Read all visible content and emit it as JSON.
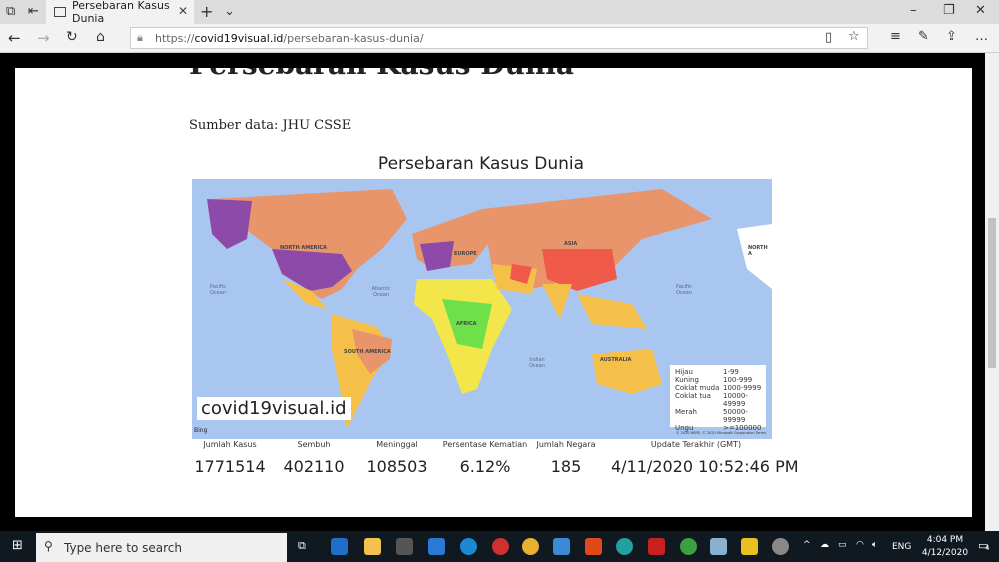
{
  "browser": {
    "tab_title": "Persebaran Kasus Dunia",
    "url_prefix": "https://",
    "url_domain": "covid19visual.id",
    "url_path": "/persebaran-kasus-dunia/"
  },
  "page": {
    "heading": "Persebaran Kasus Dunia",
    "source": "Sumber data: JHU CSSE"
  },
  "map": {
    "title": "Persebaran Kasus Dunia",
    "labels": {
      "north_america": "NORTH AMERICA",
      "europe": "EUROPE",
      "asia": "ASIA",
      "africa": "AFRICA",
      "south_america": "SOUTH AMERICA",
      "australia": "AUSTRALIA",
      "north_a": "NORTH A",
      "pacific1": "Pacific Ocean",
      "pacific2": "Pacific Ocean",
      "atlantic": "Atlantic Ocean",
      "indian": "Indian Ocean"
    },
    "legend": [
      {
        "label": "Hijau",
        "range": "1-99",
        "color": "#6ee04a"
      },
      {
        "label": "Kuning",
        "range": "100-999",
        "color": "#f2e64a"
      },
      {
        "label": "Coklat muda",
        "range": "1000-9999",
        "color": "#f5c04a"
      },
      {
        "label": "Coklat tua",
        "range": "10000-49999",
        "color": "#e8956b"
      },
      {
        "label": "Merah",
        "range": "50000-99999",
        "color": "#f05a4a"
      },
      {
        "label": "Ungu",
        "range": ">=100000",
        "color": "#8e4aa8"
      }
    ],
    "watermark": "covid19visual.id",
    "bing": "Bing",
    "copyright": "© 2020 HERE, © 2020 Microsoft Corporation Terms"
  },
  "stats": [
    {
      "label": "Jumlah Kasus",
      "value": "1771514"
    },
    {
      "label": "Sembuh",
      "value": "402110"
    },
    {
      "label": "Meninggal",
      "value": "108503"
    },
    {
      "label": "Persentase Kematian",
      "value": "6.12%"
    },
    {
      "label": "Jumlah Negara",
      "value": "185"
    },
    {
      "label": "Update Terakhir (GMT)",
      "value": "4/11/2020 10:52:46 PM"
    }
  ],
  "taskbar": {
    "search_placeholder": "Type here to search",
    "lang": "ENG",
    "time": "4:04 PM",
    "date": "4/12/2020",
    "notifications": "4"
  }
}
